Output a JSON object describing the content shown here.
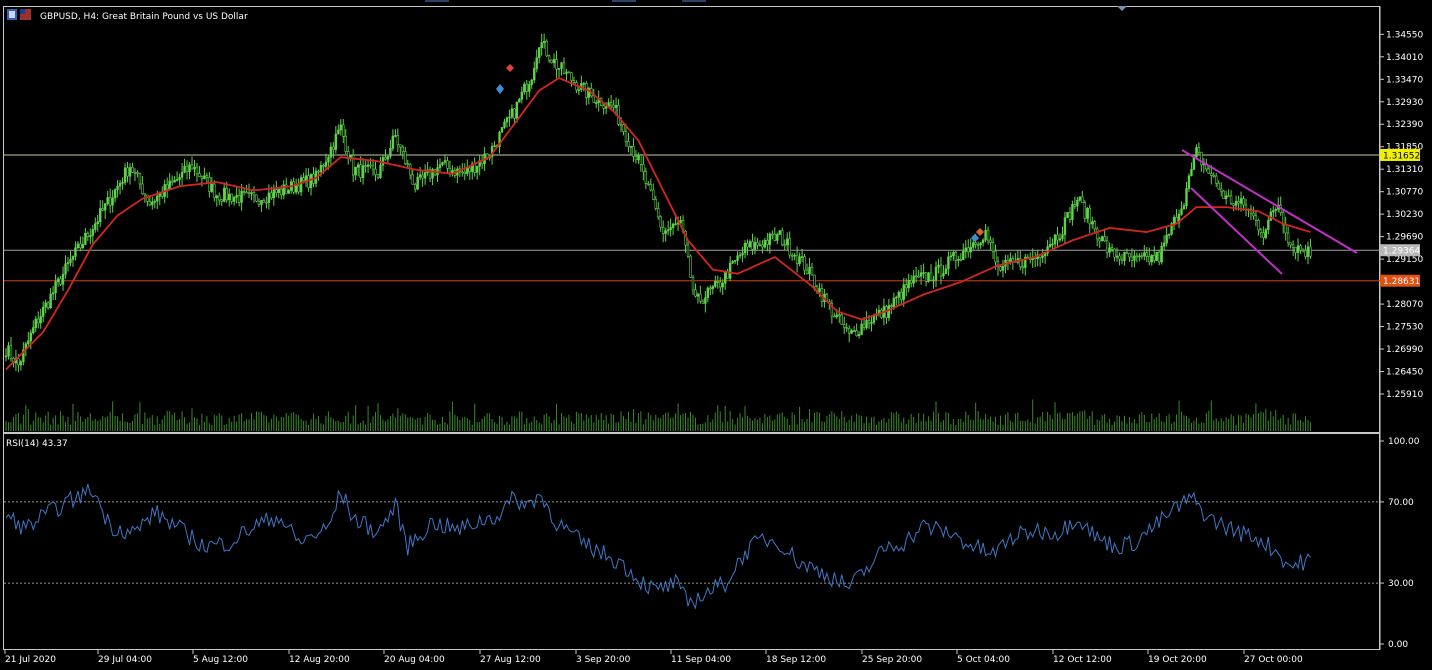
{
  "window": {
    "symbol": "GBPUSD",
    "timeframe": "H4",
    "description": "Great Britain Pound vs US Dollar"
  },
  "colors": {
    "background": "#000000",
    "frame": "#c8c8c8",
    "candle": "#5fd34a",
    "moving_average": "#d2261e",
    "rsi_line": "#3f78c6",
    "trendline": "#c030c8",
    "hline_upper": "#c8c8a0",
    "hline_mid": "#a0a0a0",
    "hline_lower": "#d23c14",
    "label_upper_bg": "#f0f000",
    "label_mid_bg": "#b8b8b8",
    "label_lower_bg": "#e05010",
    "volume": "#3a8a2a"
  },
  "price_axis": {
    "ticks": [
      "1.34550",
      "1.34010",
      "1.33470",
      "1.32930",
      "1.32390",
      "1.31850",
      "1.31310",
      "1.30770",
      "1.30230",
      "1.29690",
      "1.29150",
      "1.28070",
      "1.27530",
      "1.26990",
      "1.26450",
      "1.25910"
    ],
    "range": [
      1.2555,
      1.3475
    ]
  },
  "price_labels": {
    "upper": "1.31652",
    "mid": "1.29364",
    "lower": "1.28631"
  },
  "time_axis": {
    "labels": [
      "21 Jul 2020",
      "29 Jul 04:00",
      "5 Aug 12:00",
      "12 Aug 20:00",
      "20 Aug 04:00",
      "27 Aug 12:00",
      "3 Sep 20:00",
      "11 Sep 04:00",
      "18 Sep 12:00",
      "25 Sep 20:00",
      "5 Oct 04:00",
      "12 Oct 12:00",
      "19 Oct 20:00",
      "27 Oct 00:00"
    ]
  },
  "rsi": {
    "label": "RSI(14) 43.37",
    "levels": [
      "100.00",
      "70.00",
      "30.00",
      "0.00"
    ]
  },
  "chart_data": {
    "type": "candlestick",
    "symbol": "GBPUSD",
    "timeframe": "H4",
    "anchors": [
      [
        0,
        1.27
      ],
      [
        5,
        1.266
      ],
      [
        12,
        1.276
      ],
      [
        25,
        1.29
      ],
      [
        40,
        1.304
      ],
      [
        50,
        1.314
      ],
      [
        58,
        1.305
      ],
      [
        68,
        1.31
      ],
      [
        75,
        1.314
      ],
      [
        85,
        1.307
      ],
      [
        100,
        1.306
      ],
      [
        112,
        1.308
      ],
      [
        125,
        1.311
      ],
      [
        135,
        1.323
      ],
      [
        140,
        1.313
      ],
      [
        150,
        1.312
      ],
      [
        157,
        1.321
      ],
      [
        165,
        1.309
      ],
      [
        175,
        1.314
      ],
      [
        185,
        1.312
      ],
      [
        195,
        1.317
      ],
      [
        205,
        1.327
      ],
      [
        212,
        1.336
      ],
      [
        215,
        1.344
      ],
      [
        222,
        1.338
      ],
      [
        235,
        1.331
      ],
      [
        245,
        1.328
      ],
      [
        255,
        1.315
      ],
      [
        265,
        1.298
      ],
      [
        272,
        1.3
      ],
      [
        278,
        1.281
      ],
      [
        287,
        1.285
      ],
      [
        298,
        1.294
      ],
      [
        312,
        1.297
      ],
      [
        322,
        1.29
      ],
      [
        332,
        1.28
      ],
      [
        340,
        1.273
      ],
      [
        348,
        1.277
      ],
      [
        355,
        1.279
      ],
      [
        365,
        1.286
      ],
      [
        375,
        1.288
      ],
      [
        385,
        1.293
      ],
      [
        395,
        1.298
      ],
      [
        400,
        1.289
      ],
      [
        415,
        1.292
      ],
      [
        425,
        1.298
      ],
      [
        432,
        1.306
      ],
      [
        445,
        1.293
      ],
      [
        455,
        1.291
      ],
      [
        465,
        1.292
      ],
      [
        475,
        1.306
      ],
      [
        480,
        1.317
      ],
      [
        492,
        1.306
      ],
      [
        500,
        1.304
      ],
      [
        507,
        1.298
      ],
      [
        513,
        1.305
      ],
      [
        518,
        1.295
      ],
      [
        526,
        1.293
      ]
    ],
    "moving_average_anchors": [
      [
        0,
        1.265
      ],
      [
        15,
        1.274
      ],
      [
        25,
        1.284
      ],
      [
        35,
        1.295
      ],
      [
        45,
        1.302
      ],
      [
        55,
        1.306
      ],
      [
        70,
        1.309
      ],
      [
        85,
        1.31
      ],
      [
        100,
        1.308
      ],
      [
        115,
        1.309
      ],
      [
        125,
        1.311
      ],
      [
        135,
        1.316
      ],
      [
        150,
        1.315
      ],
      [
        165,
        1.313
      ],
      [
        180,
        1.312
      ],
      [
        195,
        1.316
      ],
      [
        205,
        1.324
      ],
      [
        215,
        1.332
      ],
      [
        223,
        1.335
      ],
      [
        235,
        1.332
      ],
      [
        245,
        1.327
      ],
      [
        255,
        1.32
      ],
      [
        265,
        1.308
      ],
      [
        275,
        1.296
      ],
      [
        285,
        1.289
      ],
      [
        295,
        1.288
      ],
      [
        310,
        1.292
      ],
      [
        325,
        1.285
      ],
      [
        335,
        1.279
      ],
      [
        345,
        1.277
      ],
      [
        355,
        1.279
      ],
      [
        370,
        1.283
      ],
      [
        385,
        1.286
      ],
      [
        400,
        1.29
      ],
      [
        415,
        1.292
      ],
      [
        430,
        1.296
      ],
      [
        445,
        1.299
      ],
      [
        460,
        1.298
      ],
      [
        472,
        1.3
      ],
      [
        480,
        1.304
      ],
      [
        492,
        1.304
      ],
      [
        505,
        1.303
      ],
      [
        515,
        1.3
      ],
      [
        526,
        1.298
      ]
    ],
    "rsi_anchors": [
      [
        0,
        63
      ],
      [
        8,
        57
      ],
      [
        15,
        63
      ],
      [
        25,
        70
      ],
      [
        35,
        76
      ],
      [
        42,
        58
      ],
      [
        52,
        55
      ],
      [
        60,
        65
      ],
      [
        72,
        55
      ],
      [
        80,
        48
      ],
      [
        90,
        50
      ],
      [
        100,
        58
      ],
      [
        110,
        63
      ],
      [
        118,
        50
      ],
      [
        130,
        57
      ],
      [
        135,
        75
      ],
      [
        140,
        62
      ],
      [
        150,
        55
      ],
      [
        157,
        68
      ],
      [
        162,
        48
      ],
      [
        172,
        60
      ],
      [
        182,
        56
      ],
      [
        192,
        61
      ],
      [
        198,
        63
      ],
      [
        205,
        72
      ],
      [
        210,
        68
      ],
      [
        215,
        74
      ],
      [
        222,
        60
      ],
      [
        232,
        50
      ],
      [
        240,
        45
      ],
      [
        248,
        40
      ],
      [
        255,
        32
      ],
      [
        262,
        26
      ],
      [
        270,
        30
      ],
      [
        275,
        20
      ],
      [
        282,
        25
      ],
      [
        290,
        30
      ],
      [
        298,
        45
      ],
      [
        305,
        52
      ],
      [
        312,
        50
      ],
      [
        320,
        40
      ],
      [
        330,
        35
      ],
      [
        340,
        28
      ],
      [
        348,
        38
      ],
      [
        355,
        48
      ],
      [
        362,
        50
      ],
      [
        370,
        58
      ],
      [
        380,
        55
      ],
      [
        390,
        48
      ],
      [
        398,
        44
      ],
      [
        405,
        52
      ],
      [
        415,
        56
      ],
      [
        425,
        55
      ],
      [
        432,
        63
      ],
      [
        440,
        52
      ],
      [
        448,
        48
      ],
      [
        455,
        50
      ],
      [
        465,
        60
      ],
      [
        472,
        67
      ],
      [
        478,
        72
      ],
      [
        485,
        62
      ],
      [
        495,
        56
      ],
      [
        505,
        52
      ],
      [
        512,
        46
      ],
      [
        518,
        38
      ],
      [
        526,
        42
      ]
    ],
    "rsi_overbought": 70,
    "rsi_oversold": 30,
    "horizontal_levels": [
      1.31652,
      1.29364,
      1.28631
    ]
  }
}
